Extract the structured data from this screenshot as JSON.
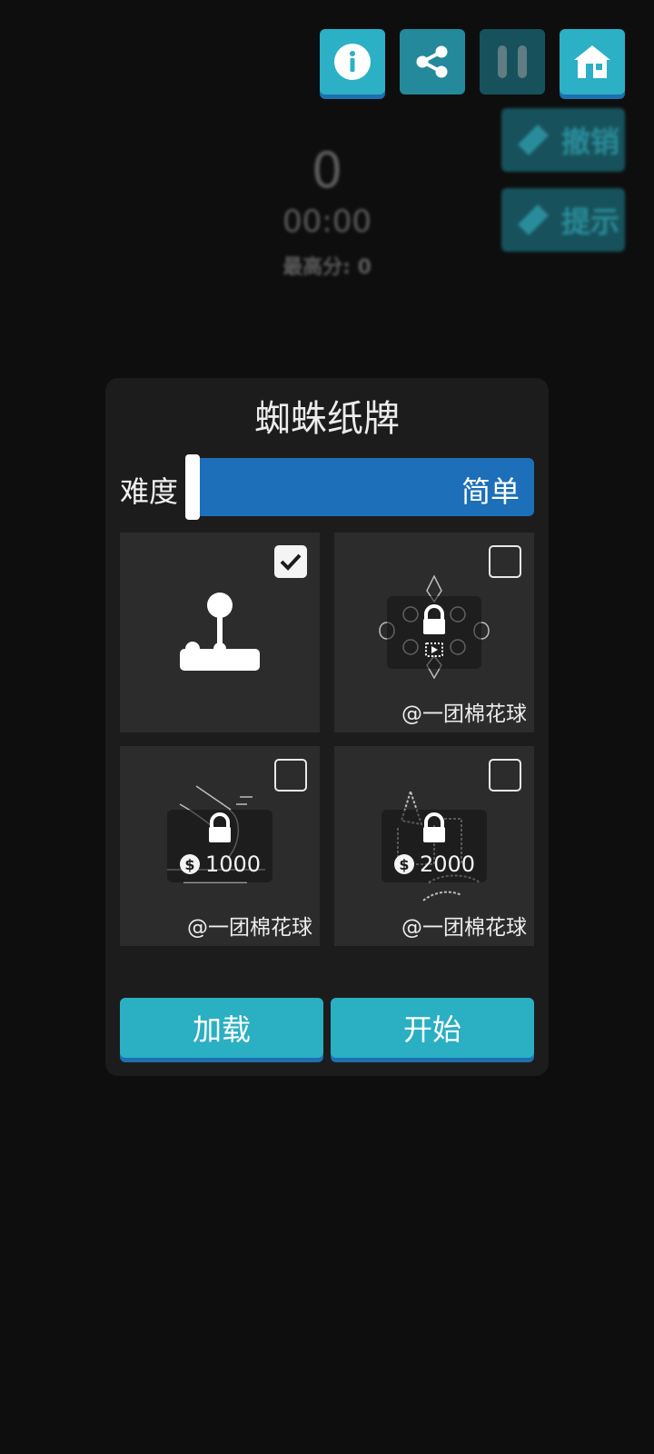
{
  "top_bar": {
    "info_icon": "info-icon",
    "share_icon": "share-icon",
    "pause_icon": "pause-icon",
    "home_icon": "home-icon"
  },
  "side_buttons": {
    "undo_label": "撤销",
    "hint_label": "提示"
  },
  "score": {
    "value": "0",
    "time": "00:00",
    "best": "最高分:  0"
  },
  "dialog": {
    "title": "蜘蛛纸牌",
    "difficulty_label": "难度",
    "difficulty_value": "简单",
    "cards": [
      {
        "selected": true,
        "locked": false,
        "icon": "joystick-icon"
      },
      {
        "selected": false,
        "locked": true,
        "unlock": "video-ad-icon",
        "credit": "@一团棉花球"
      },
      {
        "selected": false,
        "locked": true,
        "price": "1000",
        "credit": "@一团棉花球"
      },
      {
        "selected": false,
        "locked": true,
        "price": "2000",
        "credit": "@一团棉花球"
      }
    ],
    "load_label": "加载",
    "start_label": "开始"
  },
  "colors": {
    "background": "#0e0e0f",
    "accent": "#2aafc3",
    "accent_shadow": "#1e6fb0",
    "slider": "#1c6fb8",
    "dialog": "#1c1c1d",
    "card": "#2c2c2d"
  }
}
